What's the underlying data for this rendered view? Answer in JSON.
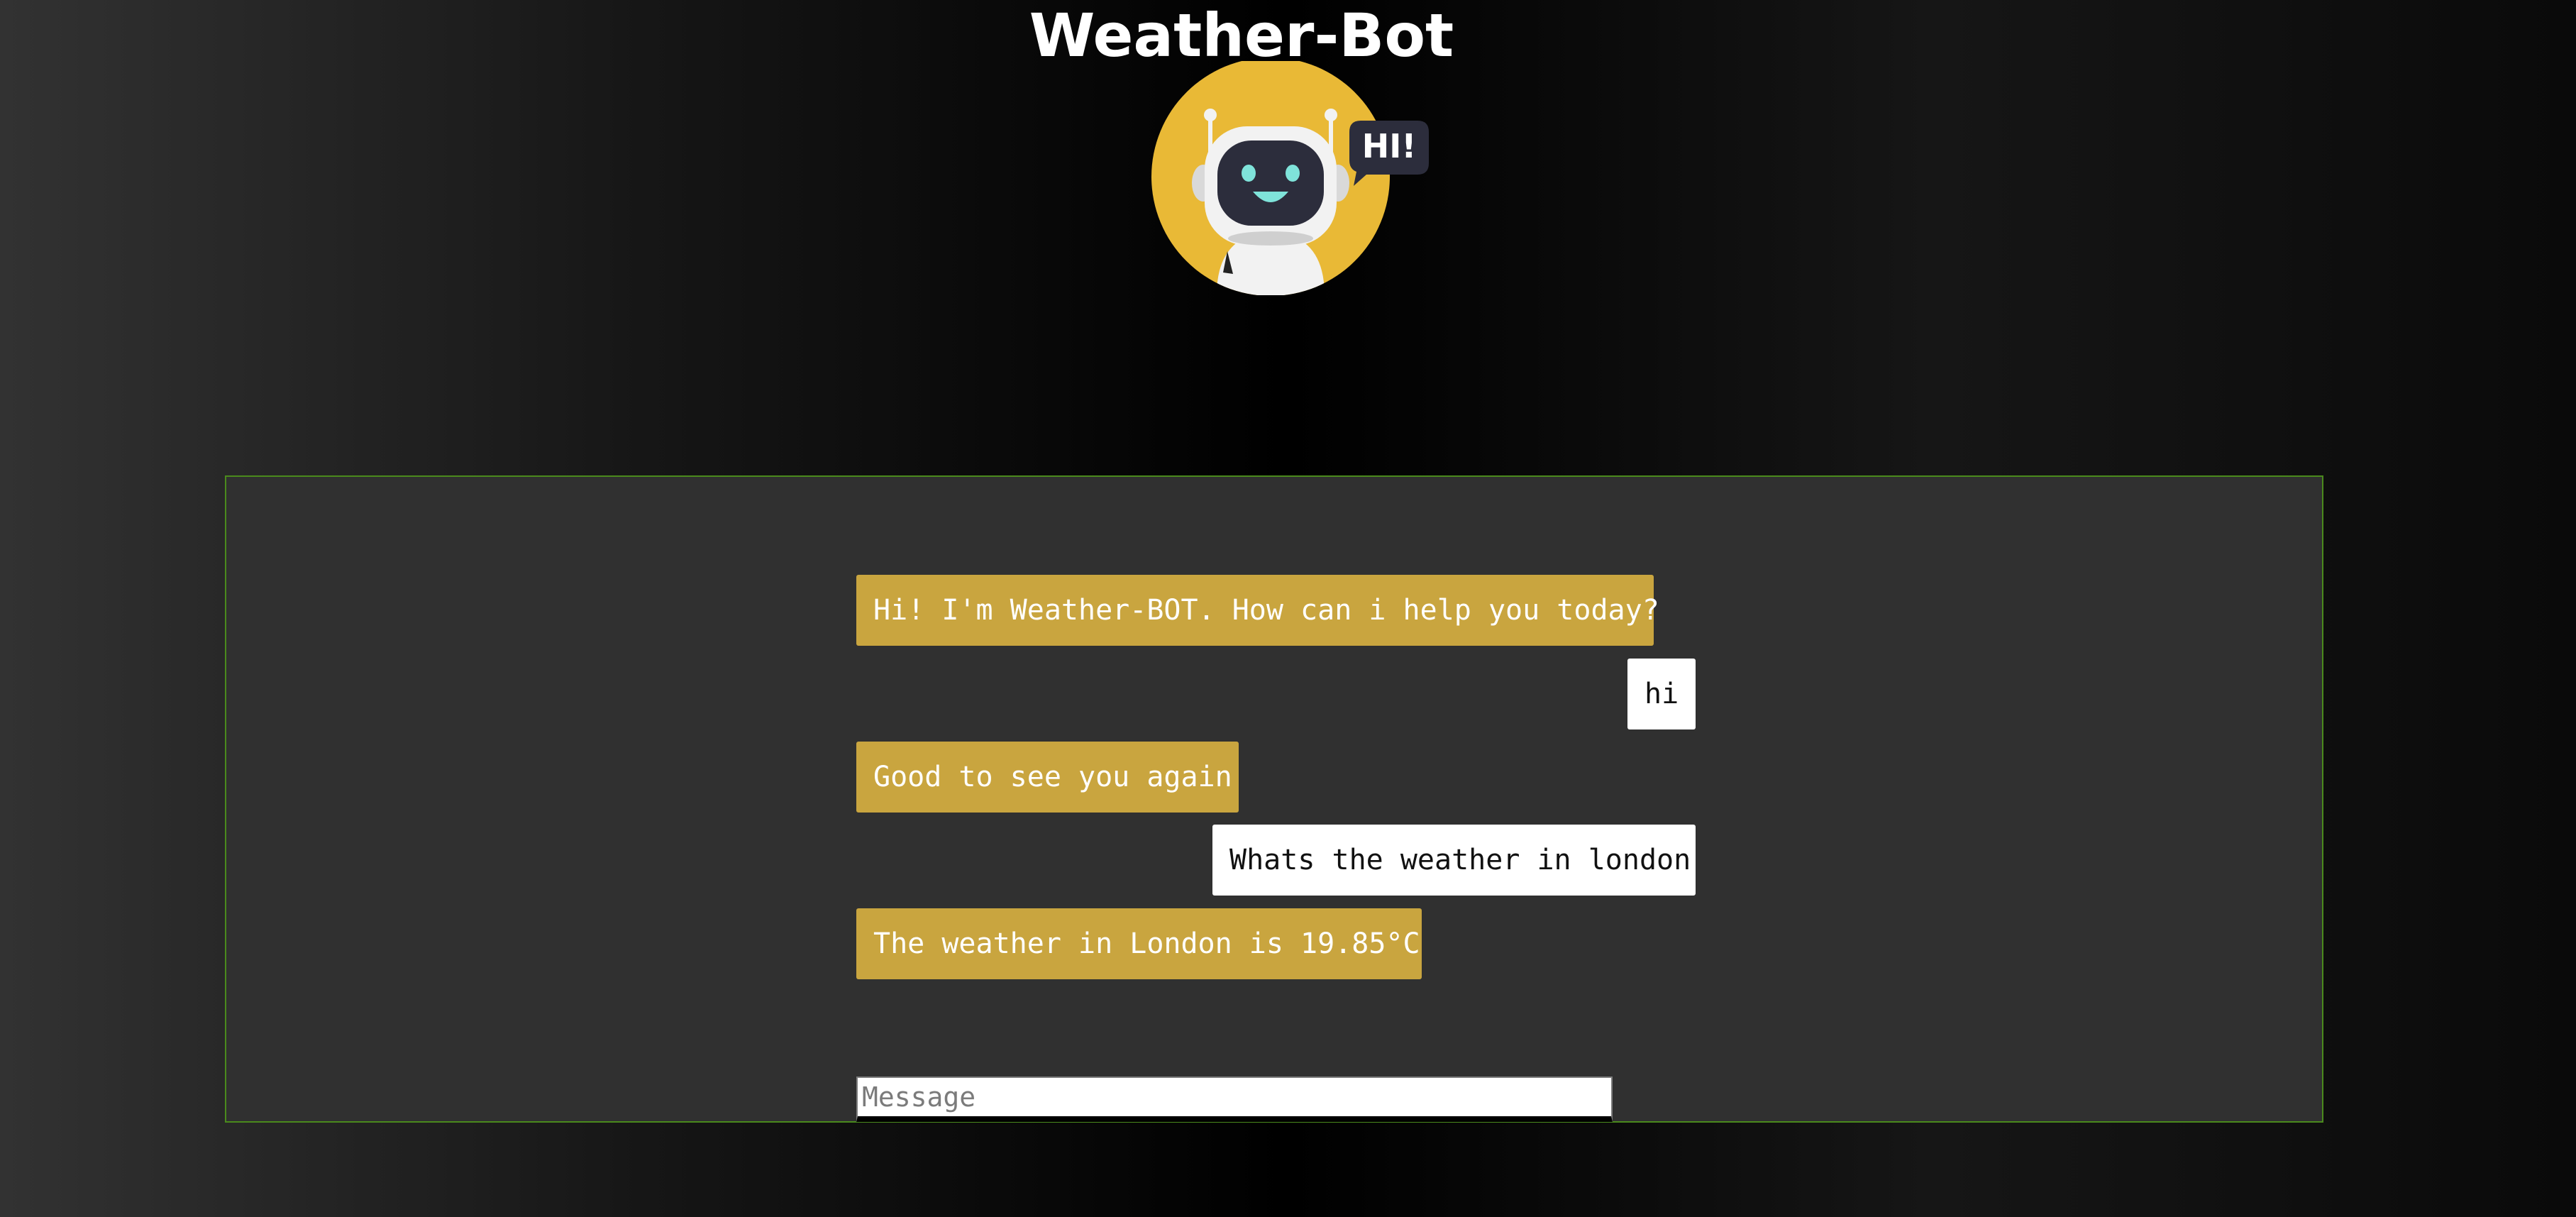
{
  "header": {
    "title": "Weather-Bot",
    "avatar_bubble_text": "HI!"
  },
  "chat": {
    "messages": [
      {
        "sender": "bot",
        "text": "Hi! I'm Weather-BOT. How can i help you today?"
      },
      {
        "sender": "user",
        "text": "hi"
      },
      {
        "sender": "bot",
        "text": "Good to see you again"
      },
      {
        "sender": "user",
        "text": "Whats the weather in london"
      },
      {
        "sender": "bot",
        "text": "The weather in London is 19.85°C"
      }
    ],
    "input": {
      "value": "",
      "placeholder": "Message"
    }
  },
  "colors": {
    "bot_bubble": "#c9a53f",
    "user_bubble": "#ffffff",
    "panel_background": "#303030",
    "panel_border": "#4a8a1c",
    "avatar_circle": "#e9b936"
  }
}
